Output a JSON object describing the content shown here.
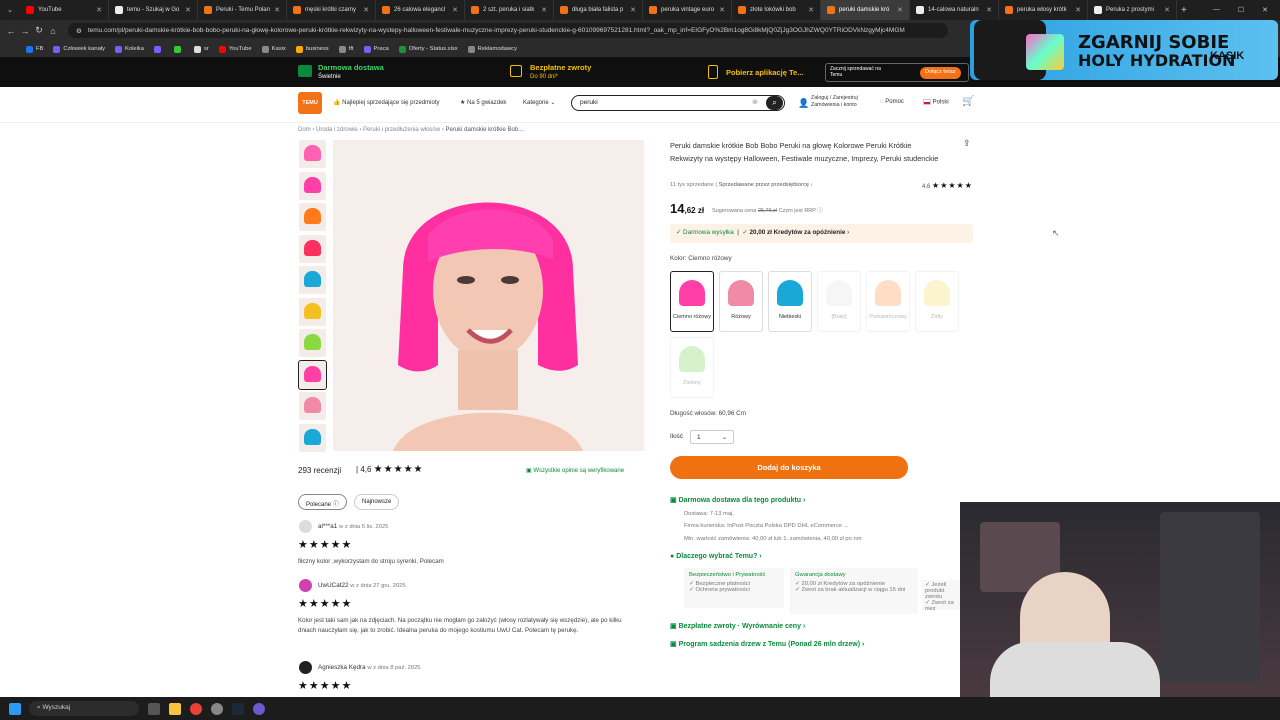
{
  "browser": {
    "tabs": [
      {
        "label": "YouTube",
        "color": "#ff0000"
      },
      {
        "label": "temu - Szukaj w Go",
        "color": "#eeeeee"
      },
      {
        "label": "Peruki - Temu Polan",
        "color": "#f47216"
      },
      {
        "label": "męski krótki czarny",
        "color": "#f47216"
      },
      {
        "label": "26 calowa elegancl",
        "color": "#f47216"
      },
      {
        "label": "2 szt. peruka i siatk",
        "color": "#f47216"
      },
      {
        "label": "długa biała falista p",
        "color": "#f47216"
      },
      {
        "label": "peruka vintage euro",
        "color": "#f47216"
      },
      {
        "label": "złote lokówki bob",
        "color": "#f47216"
      },
      {
        "label": "peruki damskie kró",
        "color": "#f47216",
        "active": true
      },
      {
        "label": "14-calowa naturaln",
        "color": "#eeeeee"
      },
      {
        "label": "peruka włosy krótk",
        "color": "#f47216"
      },
      {
        "label": "Peruka z prostymi",
        "color": "#eeeeee"
      }
    ],
    "new_tab": "+",
    "url": "temu.com/pl/peruki-damskie-krótkie-bob-bobo-peruki-na-głowę-kolorowe-peruki-krótkie-rekwizyty-na-wystepy-halloween-festiwale-muzyczne-imprezy-peruki-studenckie-g-601099697521281.html?_oak_mp_inf=EIGFyO%2Bm1og8Gi8kMjQ0ZjJg3OGJhZWQ0YTRiODVkNzgyMjc4MGM",
    "bookmarks": [
      {
        "label": "FB",
        "color": "#1877f2"
      },
      {
        "label": "Człowiek kanały",
        "color": "#7b5cff"
      },
      {
        "label": "Koleika",
        "color": "#7b5cff"
      },
      {
        "label": "",
        "color": "#7b5cff"
      },
      {
        "label": "",
        "color": "#33cc33"
      },
      {
        "label": "sr",
        "color": "#dddddd"
      },
      {
        "label": "YouTube",
        "color": "#ff0000"
      },
      {
        "label": "Kasix",
        "color": "#888888"
      },
      {
        "label": "business",
        "color": "#ffaa00"
      },
      {
        "label": "tft",
        "color": "#888888"
      },
      {
        "label": "Praca",
        "color": "#7b5cff"
      },
      {
        "label": "Oferty - Status.xlsx",
        "color": "#1e8f3e"
      },
      {
        "label": "Reklamodawcy",
        "color": "#888888"
      }
    ]
  },
  "promo": {
    "free_shipping": "Darmowa dostawa",
    "free_shipping_sub": "Świetnie",
    "free_returns": "Bezpłatne zwroty",
    "free_returns_sub": "Do 90 dni*",
    "app": "Pobierz aplikację Te...",
    "join_text": "Zacznij sprzedawać na Temu",
    "join_btn": "Dołącz teraz"
  },
  "ad": {
    "title_line1": "ZGARNIJ SOBIE",
    "title_line2": "HOLY HYDRATION",
    "brand": "KASIK"
  },
  "header": {
    "logo": "TEMU",
    "bestsellers": "Najlepiej sprzedające się przedmioty",
    "five_star": "Na 5 gwiazdek",
    "categories": "Kategorie",
    "search_value": "peruki",
    "login_line1": "Zaloguj / Zarejestruj",
    "login_line2": "Zamówienia i konto",
    "help": "Pomoc",
    "language": "Polski"
  },
  "breadcrumb": [
    "Dom",
    "Uroda i zdrowie",
    "Peruki i przedłużenia włosów",
    "Peruki damskie krótkie Bob..."
  ],
  "product": {
    "title": "Peruki damskie krótkie Bob Bobo Peruki na głowę Kolorowe Peruki Krótkie Rekwizyty na występy Halloween, Festiwale muzyczne, Imprezy, Peruki studenckie",
    "sold": "11 tys sprzedane",
    "seller": "Sprzedawane przez przedsiębiorcę",
    "rating": "4,6",
    "price_main": "14",
    "price_dec": ",62 zł",
    "rrp_label": "Sugerowana cena",
    "rrp_value": "25,76 zł",
    "rrp_suffix": "Czym jest RRP",
    "ship_free": "Darmowa wysyłka",
    "credit": "20,00 zł Kredytów za opóźnienie",
    "color_label": "Kolor: Ciemno różowy",
    "swatches": [
      {
        "label": "Ciemno różowy",
        "color": "#ff3fa6",
        "disabled": false
      },
      {
        "label": "Różowy",
        "color": "#f08aa6",
        "disabled": false
      },
      {
        "label": "Niebieski",
        "color": "#1aa8d8",
        "disabled": false
      },
      {
        "label": "[Biały]",
        "color": "#e8e8e8",
        "disabled": true
      },
      {
        "label": "Pomarańczowy",
        "color": "#ffa060",
        "disabled": true
      },
      {
        "label": "Żółty",
        "color": "#f5e070",
        "disabled": true
      },
      {
        "label": "Zielony",
        "color": "#8cd870",
        "disabled": true
      }
    ],
    "length": "Długość włosów: 60,96 Cm",
    "qty_label": "Ilość",
    "qty_value": "1",
    "add_to_cart": "Dodaj do koszyka",
    "delivery_title": "Darmowa dostawa dla tego produktu",
    "delivery_time": "Dostawa: 7-13 maj.",
    "couriers": "Firma kurierska: InPost Poczta Polska DPD DHL eCommerce ...",
    "min_order": "Min. wartość zamówienia: 40,00 zł lub 1. zamówienia, 40,00 zł po nm",
    "why_title": "Dlaczego wybrać Temu?",
    "security_title": "Bezpieczeństwo i Prywatność",
    "security_items": [
      "Bezpieczne płatności",
      "Ochrona prywatności"
    ],
    "guarantee_title": "Gwarancja dostawy",
    "guarantee_items": [
      "20,00 zł Kredytów za opóźnienie",
      "Zwrot za brak aktualizacji w ciągu 15 dni"
    ],
    "extra_items": [
      "Jeżeli produkt zwrotu",
      "Zwrot za niez"
    ],
    "returns_link": "Bezpłatne zwroty · Wyrównanie ceny",
    "trees_link": "Program sadzenia drzew z Temu (Ponad 26 mln drzew)"
  },
  "thumbs": [
    "#ff60b0",
    "#ff3fa6",
    "#ff7a1a",
    "#ff3060",
    "#1aa8d8",
    "#f5c020",
    "#8cd840",
    "#ff3fa6",
    "#f08aa6",
    "#1aa8d8"
  ],
  "reviews": {
    "count": "293 recenzji",
    "rating": "4,6",
    "verified": "Wszystkie opinie są weryfikowane",
    "filter_recommended": "Polecane",
    "filter_newest": "Najnowsze",
    "items": [
      {
        "name": "al***a1",
        "meta": "w z dnia 5 lis. 2025",
        "text": "fiłczny kolor ,wykorzystam do stroju syrenki. Polecam"
      },
      {
        "name": "UwUCat22",
        "meta": "w z dnia 27 gru. 2025",
        "text": "Kolor jest taki sam jak na zdjęciach. Na początku nie mogłam go założyć (włosy rozlatywały się wszędzie), ale po kilku dniach nauczyłam się, jak to zrobić. Idealna peruka do mojego kostiumu UwU Cat. Polecam tę perukę."
      },
      {
        "name": "Agnieszka Kędra",
        "meta": "w z dnia 8 paź. 2025",
        "text": ""
      }
    ]
  },
  "taskbar": {
    "search": "Wyszukaj"
  }
}
